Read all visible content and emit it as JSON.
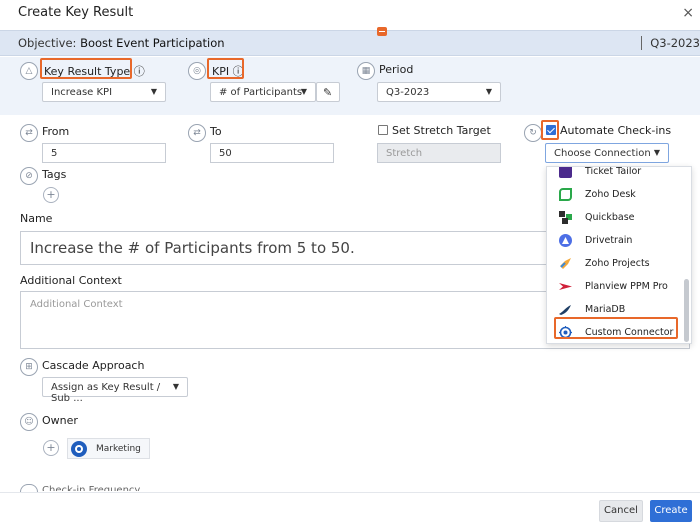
{
  "modal": {
    "title": "Create Key Result",
    "close": "×"
  },
  "objective": {
    "label": "Objective:",
    "value": "Boost Event Participation",
    "period": "Q3-2023"
  },
  "key_result_type": {
    "label": "Key Result Type",
    "info": "ⓘ",
    "value": "Increase KPI"
  },
  "kpi": {
    "label": "KPI",
    "info": "ⓘ",
    "value": "# of Participants"
  },
  "period": {
    "label": "Period",
    "value": "Q3-2023"
  },
  "from": {
    "label": "From",
    "value": "5"
  },
  "to": {
    "label": "To",
    "value": "50"
  },
  "stretch": {
    "label": "Set Stretch Target",
    "placeholder": "Stretch",
    "checked": false
  },
  "automate": {
    "label": "Automate Check-ins",
    "checked": true,
    "select_value": "Choose Connection"
  },
  "tags": {
    "label": "Tags"
  },
  "name": {
    "label": "Name",
    "value": "Increase the # of Participants from 5 to 50."
  },
  "context": {
    "label": "Additional Context",
    "placeholder": "Additional Context"
  },
  "cascade": {
    "label": "Cascade Approach",
    "value": "Assign as Key Result / Sub ..."
  },
  "owner": {
    "label": "Owner",
    "name": "Marketing"
  },
  "check_in_partial": "Check-in Frequency",
  "connections": [
    {
      "label": "Ticket Tailor",
      "icon": "ticket-tailor-icon",
      "color": "#4b2a8c"
    },
    {
      "label": "Zoho Desk",
      "icon": "zoho-desk-icon",
      "color": "#2aa84a"
    },
    {
      "label": "Quickbase",
      "icon": "quickbase-icon",
      "color": "#2d2d2d"
    },
    {
      "label": "Drivetrain",
      "icon": "drivetrain-icon",
      "color": "#4d6fe6"
    },
    {
      "label": "Zoho Projects",
      "icon": "zoho-projects-icon",
      "color": "#f2a83a"
    },
    {
      "label": "Planview PPM Pro",
      "icon": "planview-icon",
      "color": "#d0213a"
    },
    {
      "label": "MariaDB",
      "icon": "mariadb-icon",
      "color": "#1f3f66"
    },
    {
      "label": "Custom Connector",
      "icon": "custom-connector-icon",
      "color": "#1f5dbd"
    }
  ],
  "footer": {
    "cancel": "Cancel",
    "create": "Create"
  },
  "colors": {
    "highlight": "#e8682a",
    "primary": "#2f6fd6",
    "band": "#eef3fa"
  }
}
